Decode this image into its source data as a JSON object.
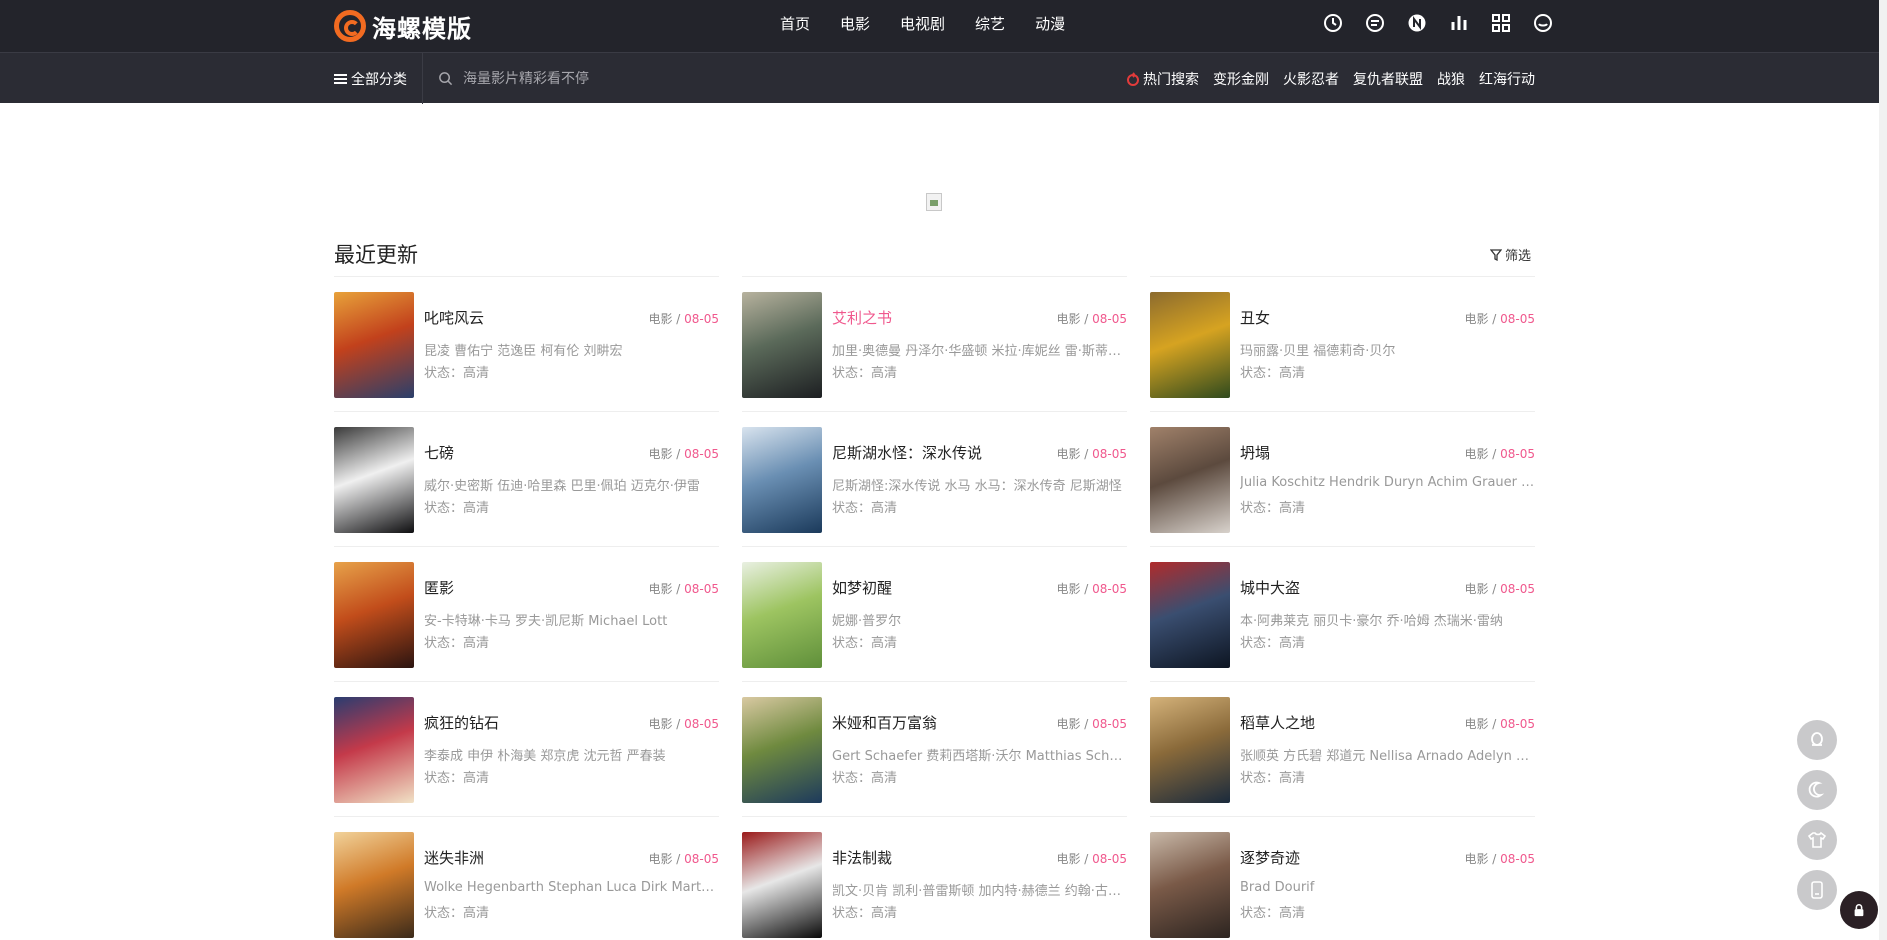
{
  "brand": {
    "name": "海螺模版",
    "accent": "#f26b21"
  },
  "nav": {
    "items": [
      "首页",
      "电影",
      "电视剧",
      "综艺",
      "动漫"
    ]
  },
  "tools": [
    "clock-icon",
    "message-icon",
    "notice-icon",
    "chart-icon",
    "grid-icon",
    "face-icon"
  ],
  "subbar": {
    "category_label": "全部分类",
    "search_placeholder": "海量影片精彩看不停",
    "hot_label": "热门搜索",
    "hot_items": [
      "变形金刚",
      "火影忍者",
      "复仇者联盟",
      "战狼",
      "红海行动"
    ]
  },
  "section": {
    "title": "最近更新",
    "filter_label": "筛选"
  },
  "colors": {
    "pink": "#f0588d",
    "topbar": "#23242b",
    "subbar": "#2b2c34"
  },
  "movies": [
    {
      "title": "叱咤风云",
      "type": "电影 / ",
      "date": "08-05",
      "actors": "昆凌 曹佑宁 范逸臣 柯有伦 刘畊宏",
      "status": "状态：高清",
      "highlight": false
    },
    {
      "title": "艾利之书",
      "type": "电影 / ",
      "date": "08-05",
      "actors": "加里·奥德曼 丹泽尔·华盛顿 米拉·库妮丝 雷·斯蒂文森 詹妮弗·碧尔斯",
      "status": "状态：高清",
      "highlight": true
    },
    {
      "title": "丑女",
      "type": "电影 / ",
      "date": "08-05",
      "actors": "玛丽露·贝里 福德莉奇·贝尔",
      "status": "状态：高清",
      "highlight": false
    },
    {
      "title": "七磅",
      "type": "电影 / ",
      "date": "08-05",
      "actors": "威尔·史密斯 伍迪·哈里森 巴里·佩珀 迈克尔·伊雷",
      "status": "状态：高清",
      "highlight": false
    },
    {
      "title": "尼斯湖水怪：深水传说",
      "type": "电影 / ",
      "date": "08-05",
      "actors": "尼斯湖怪:深水传说 水马 水马：深水传奇 尼斯湖怪",
      "status": "状态：高清",
      "highlight": false
    },
    {
      "title": "坍塌",
      "type": "电影 / ",
      "date": "08-05",
      "actors": "Julia Koschitz Hendrik Duryn Achim Grauer Dieter",
      "status": "状态：高清",
      "highlight": false
    },
    {
      "title": "匿影",
      "type": "电影 / ",
      "date": "08-05",
      "actors": "安-卡特琳·卡马 罗夫·凯尼斯 Michael Lott",
      "status": "状态：高清",
      "highlight": false
    },
    {
      "title": "如梦初醒",
      "type": "电影 / ",
      "date": "08-05",
      "actors": "妮娜·普罗尔",
      "status": "状态：高清",
      "highlight": false
    },
    {
      "title": "城中大盗",
      "type": "电影 / ",
      "date": "08-05",
      "actors": "本·阿弗莱克 丽贝卡·豪尔 乔·哈姆 杰瑞米·雷纳",
      "status": "状态：高清",
      "highlight": false
    },
    {
      "title": "疯狂的钻石",
      "type": "电影 / ",
      "date": "08-05",
      "actors": "李泰成 申伊 朴海美 郑京虎 沈元哲 严春装",
      "status": "状态：高清",
      "highlight": false
    },
    {
      "title": "米娅和百万富翁",
      "type": "电影 / ",
      "date": "08-05",
      "actors": "Gert Schaefer 费莉西塔斯·沃尔 Matthias Schweighöfer",
      "status": "状态：高清",
      "highlight": false
    },
    {
      "title": "稻草人之地",
      "type": "电影 / ",
      "date": "08-05",
      "actors": "张顺英 方氏碧 郑道元 Nellisa Arnado Adelyn Ferrer",
      "status": "状态：高清",
      "highlight": false
    },
    {
      "title": "迷失非洲",
      "type": "电影 / ",
      "date": "08-05",
      "actors": "Wolke Hegenbarth Stephan Luca Dirk Martens",
      "status": "状态：高清",
      "highlight": false
    },
    {
      "title": "非法制裁",
      "type": "电影 / ",
      "date": "08-05",
      "actors": "凯文·贝肯 凯利·普雷斯顿 加内特·赫德兰 约翰·古德曼",
      "status": "状态：高清",
      "highlight": false
    },
    {
      "title": "逐梦奇迹",
      "type": "电影 / ",
      "date": "08-05",
      "actors": "Brad Dourif",
      "status": "状态：高清",
      "highlight": false
    }
  ],
  "posters": [
    [
      "#2a3f6b",
      "#c2411c",
      "#e8a23a"
    ],
    [
      "#1d1f22",
      "#5b6a5a",
      "#b7b29e"
    ],
    [
      "#2f4a1e",
      "#d6a321",
      "#8c6b2e"
    ],
    [
      "#0e0e10",
      "#f0f0f0",
      "#3a3a3a"
    ],
    [
      "#1b3a5b",
      "#6a8fb3",
      "#d8e3ee"
    ],
    [
      "#d8d2cc",
      "#5c4a3e",
      "#a0816a"
    ],
    [
      "#2b1410",
      "#c24d1b",
      "#e7a24a"
    ],
    [
      "#5f8f3a",
      "#9dc461",
      "#e9f0e2"
    ],
    [
      "#0d1522",
      "#3a4e70",
      "#b02b2b"
    ],
    [
      "#f1e2c6",
      "#c43a4a",
      "#2a3c70"
    ],
    [
      "#1d3a5c",
      "#6f8a3f",
      "#d9c9a2"
    ],
    [
      "#1a2a3c",
      "#8a6a3a",
      "#d4b27a"
    ],
    [
      "#3b2a1a",
      "#d07a28",
      "#f1d29a"
    ],
    [
      "#0a0a0a",
      "#e7e7e7",
      "#9a1a1a"
    ],
    [
      "#2c2420",
      "#7a5a48",
      "#c8b8a8"
    ]
  ],
  "floating": [
    "qq-icon",
    "moon-icon",
    "shirt-icon",
    "phone-icon"
  ]
}
